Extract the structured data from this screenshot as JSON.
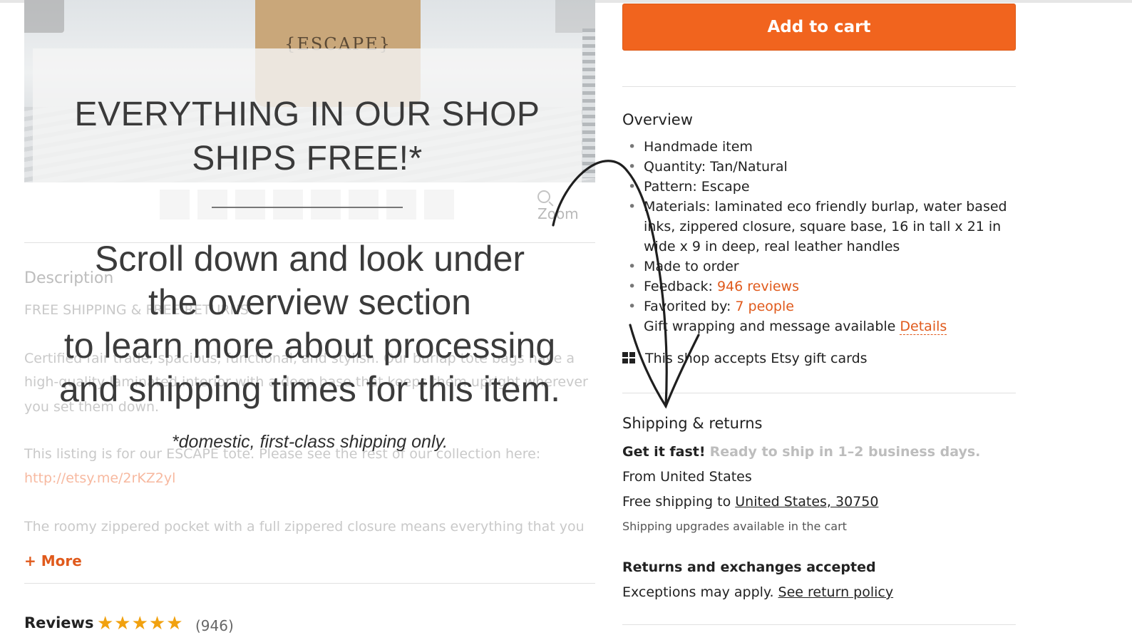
{
  "hero": {
    "bag_label": "{ESCAPE}",
    "promo_title_line1": "EVERYTHING IN OUR SHOP",
    "promo_title_line2": "SHIPS FREE!*",
    "zoom_label": "Zoom"
  },
  "overlay": {
    "line1": "Scroll down and look under",
    "line2": "the overview section",
    "line3": "to learn more about processing",
    "line4": "and shipping times for this item.",
    "note": "*domestic, first-class shipping only."
  },
  "description": {
    "heading": "Description",
    "line1": "FREE SHIPPING & FREE RETURNS",
    "line2": "Certified fair trade, spacious, functional, and stylish. Our burlap tote bags have a",
    "line3": "high-quality laminated interior with a deep base that keeps them upright wherever",
    "line4": "you set them down.",
    "line5": "This listing is for our ESCAPE tote. Please see the rest of our collection here:",
    "link": "http://etsy.me/2rKZ2yl",
    "line6": "The roomy zippered pocket with a full zippered closure means everything that you",
    "more_label": "+ More"
  },
  "reviews": {
    "label": "Reviews",
    "stars": "★★★★★",
    "count": "(946)"
  },
  "buy": {
    "add_to_cart": "Add to cart"
  },
  "overview": {
    "title": "Overview",
    "items": [
      "Handmade item",
      "Quantity: Tan/Natural",
      "Pattern: Escape",
      "Materials: laminated eco friendly burlap, water based inks, zippered closure, square base, 16 in tall x 21 in wide x 9 in deep, real leather handles",
      "Made to order"
    ],
    "feedback_label": "Feedback:",
    "feedback_link": "946 reviews",
    "favorited_label": "Favorited by:",
    "favorited_link": "7 people",
    "gift_wrap_label": "Gift wrapping and message available",
    "gift_wrap_link": "Details",
    "gift_cards": "This shop accepts Etsy gift cards"
  },
  "shipping": {
    "title": "Shipping & returns",
    "fast_label": "Get it fast!",
    "fast_detail": "Ready to ship in 1–2 business days.",
    "from": "From United States",
    "free_label": "Free shipping to",
    "free_location": "United States, 30750",
    "upgrades": "Shipping upgrades available in the cart",
    "returns_title": "Returns and exchanges accepted",
    "exceptions_label": "Exceptions may apply.",
    "return_policy_link": "See return policy"
  },
  "colors": {
    "accent": "#f1641e",
    "link": "#e05a1c",
    "stars": "#f1a10f"
  },
  "icons": [
    "search-icon",
    "gift-card-icon",
    "star-icon",
    "hand-drawn-arrow"
  ]
}
